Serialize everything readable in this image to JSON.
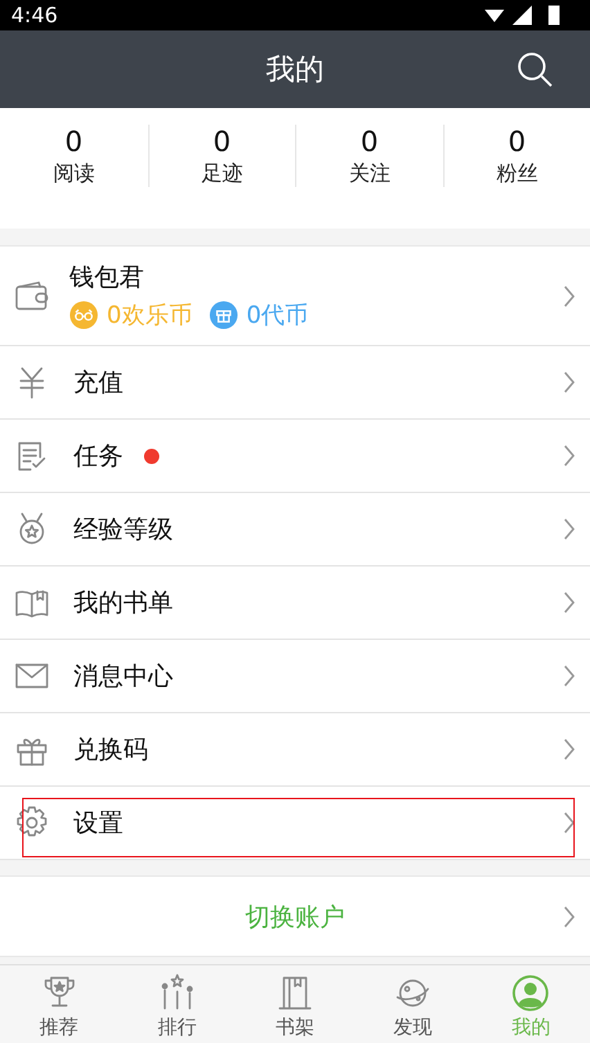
{
  "status_bar": {
    "time": "4:46"
  },
  "header": {
    "title": "我的"
  },
  "stats": [
    {
      "value": "0",
      "label": "阅读"
    },
    {
      "value": "0",
      "label": "足迹"
    },
    {
      "value": "0",
      "label": "关注"
    },
    {
      "value": "0",
      "label": "粉丝"
    }
  ],
  "wallet": {
    "title": "钱包君",
    "coins": [
      {
        "kind": "happy",
        "text": "0欢乐币",
        "color": "#f5b731"
      },
      {
        "kind": "gift",
        "text": "0代币",
        "color": "#4aa8f0"
      }
    ]
  },
  "menu": [
    {
      "kind": "yuan",
      "label": "充值",
      "dot": false,
      "highlighted": false
    },
    {
      "kind": "task",
      "label": "任务",
      "dot": true,
      "highlighted": false
    },
    {
      "kind": "medal",
      "label": "经验等级",
      "dot": false,
      "highlighted": false
    },
    {
      "kind": "book",
      "label": "我的书单",
      "dot": false,
      "highlighted": false
    },
    {
      "kind": "mail",
      "label": "消息中心",
      "dot": false,
      "highlighted": false
    },
    {
      "kind": "gift",
      "label": "兑换码",
      "dot": false,
      "highlighted": false
    },
    {
      "kind": "gear",
      "label": "设置",
      "dot": false,
      "highlighted": true
    }
  ],
  "switch_account": "切换账户",
  "tabs": [
    {
      "kind": "trophy",
      "label": "推荐",
      "selected": false
    },
    {
      "kind": "stars",
      "label": "排行",
      "selected": false
    },
    {
      "kind": "shelf",
      "label": "书架",
      "selected": false
    },
    {
      "kind": "planet",
      "label": "发现",
      "selected": false
    },
    {
      "kind": "user",
      "label": "我的",
      "selected": true
    }
  ]
}
